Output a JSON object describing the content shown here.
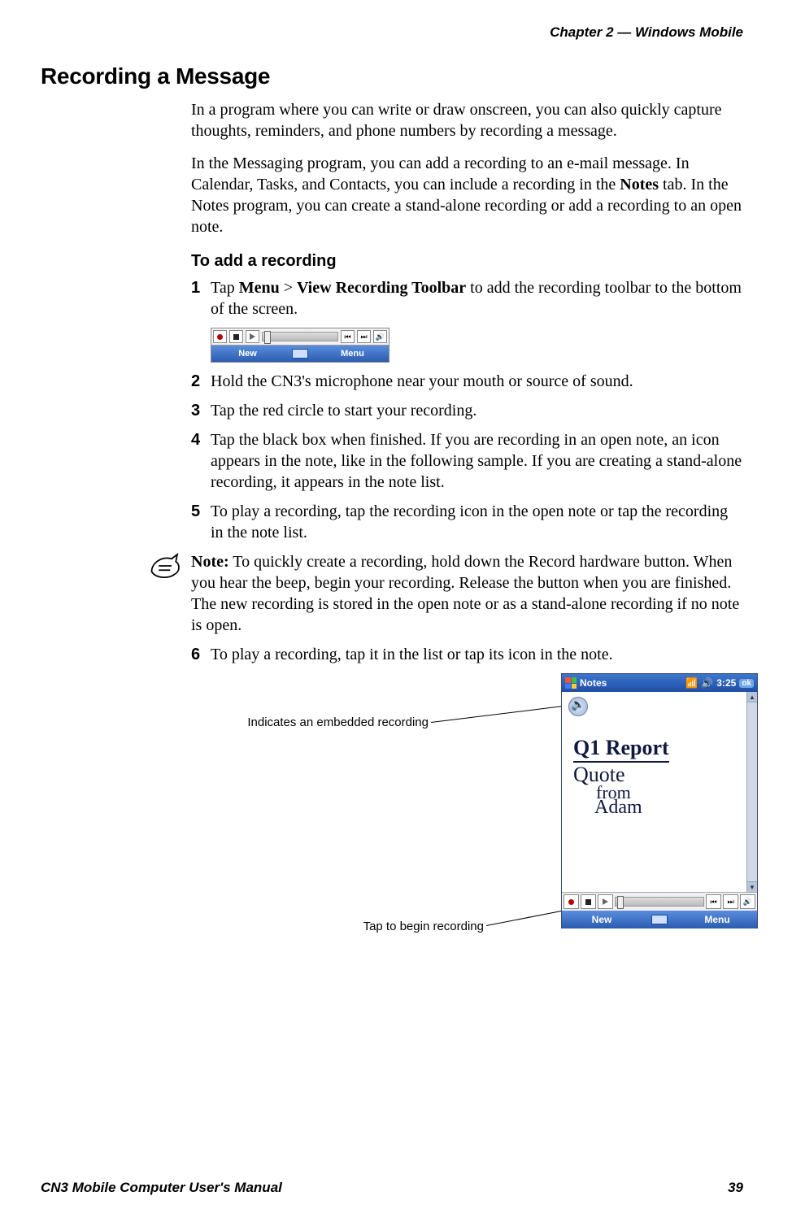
{
  "header": {
    "chapter_label": "Chapter 2 —  Windows Mobile"
  },
  "section": {
    "title": "Recording a Message"
  },
  "paragraphs": {
    "p1": "In a program where you can write or draw onscreen, you can also quickly capture thoughts, reminders, and phone numbers by recording a message.",
    "p2_a": "In the Messaging program, you can add a recording to an e-mail message. In Calendar, Tasks, and Contacts, you can include a recording in the ",
    "p2_bold": "Notes",
    "p2_b": " tab. In the Notes program, you can create a stand-alone recording or add a recording to an open note."
  },
  "procedure": {
    "title": "To add a recording"
  },
  "steps": {
    "s1_a": "Tap ",
    "s1_b1": "Menu",
    "s1_mid": " > ",
    "s1_b2": "View Recording Toolbar",
    "s1_c": " to add the recording toolbar to the bottom of the screen.",
    "s2": "Hold the CN3's microphone near your mouth or source of sound.",
    "s3": "Tap the red circle to start your recording.",
    "s4": "Tap the black box when finished. If you are recording in an open note, an icon appears in the note, like in the following sample. If you are creating a stand-alone recording, it appears in the note list.",
    "s5": "To play a recording, tap the recording icon in the open note or tap the recording in the note list.",
    "s6": "To play a recording, tap it in the list or tap its icon in the note."
  },
  "note": {
    "label": "Note:",
    "text": " To quickly create a recording, hold down the Record hardware button. When you hear the beep, begin your recording. Release the button when you are finished. The new recording is stored in the open note or as a stand-alone recording if no note is open."
  },
  "toolbar_small": {
    "left": "New",
    "right": "Menu"
  },
  "callouts": {
    "c1": "Indicates an embedded recording",
    "c2": "Tap to begin recording"
  },
  "device": {
    "title": "Notes",
    "clock": "3:25",
    "ok": "ok",
    "handwriting": {
      "l1": "Q1 Report",
      "l2": "Quote",
      "l3": "from",
      "l4": "Adam"
    },
    "bottombar": {
      "left": "New",
      "right": "Menu"
    }
  },
  "footer": {
    "left": "CN3 Mobile Computer User's Manual",
    "right": "39"
  }
}
